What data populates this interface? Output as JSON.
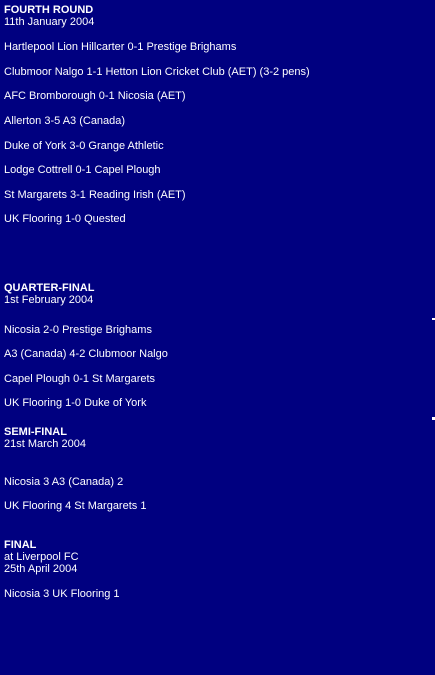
{
  "fourth_round": {
    "title": "FOURTH ROUND",
    "date": "11th January 2004",
    "matches": [
      "Hartlepool Lion Hillcarter 0-1 Prestige Brighams",
      "Clubmoor Nalgo 1-1 Hetton Lion Cricket Club (AET) (3-2 pens)",
      "AFC Bromborough 0-1 Nicosia (AET)",
      "Allerton 3-5 A3 (Canada)",
      "Duke of York 3-0 Grange Athletic",
      "Lodge Cottrell 0-1 Capel Plough",
      "St Margarets 3-1 Reading Irish (AET)",
      "UK Flooring 1-0 Quested"
    ]
  },
  "quarter_final": {
    "title": "QUARTER-FINAL",
    "date": "1st February 2004",
    "matches": [
      "Nicosia 2-0 Prestige Brighams",
      "A3 (Canada) 4-2 Clubmoor Nalgo",
      "Capel Plough 0-1 St Margarets",
      "UK Flooring 1-0 Duke of York"
    ]
  },
  "semi_final": {
    "title": "SEMI-FINAL",
    "date": "21st March 2004",
    "matches": [
      "Nicosia 3 A3 (Canada) 2",
      "UK Flooring 4 St Margarets 1"
    ]
  },
  "final": {
    "title": "FINAL",
    "venue": "at Liverpool FC",
    "date": "25th April 2004",
    "matches": [
      "Nicosia 3 UK Flooring 1"
    ]
  }
}
